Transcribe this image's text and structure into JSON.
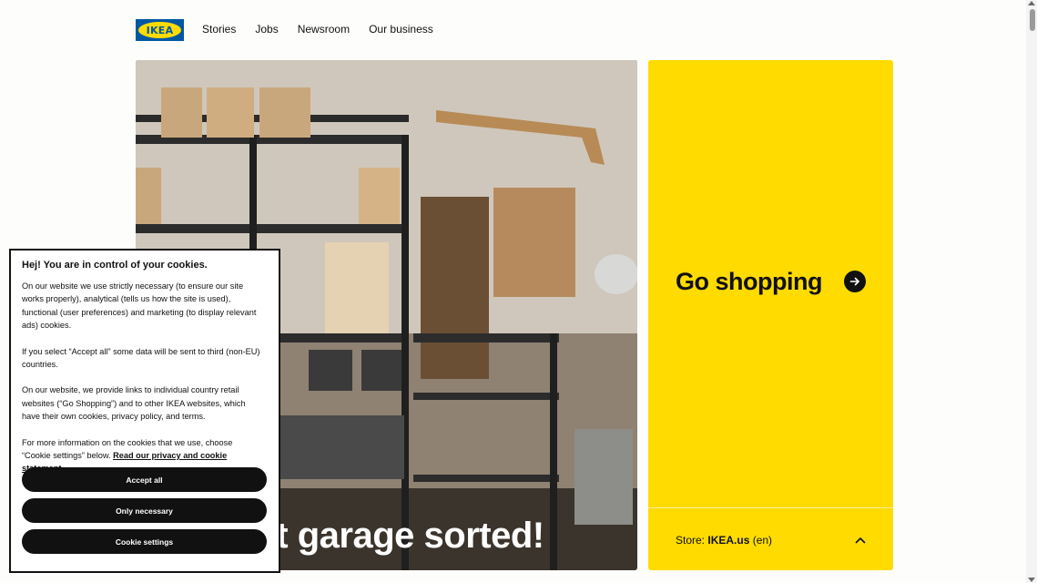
{
  "header": {
    "logo_text": "IKEA",
    "nav": [
      "Stories",
      "Jobs",
      "Newsroom",
      "Our business"
    ]
  },
  "hero": {
    "title": "Get that garage sorted!"
  },
  "shop": {
    "title": "Go shopping",
    "store_prefix": "Store: ",
    "store_name": "IKEA.us",
    "store_lang": " (en)"
  },
  "cookie": {
    "title": "Hej! You are in control of your cookies.",
    "p1": "On our website we use strictly necessary (to ensure our site works properly), analytical (tells us how the site is used), functional (user preferences) and marketing (to display relevant ads) cookies.",
    "p2": "If you select “Accept all” some data will be sent to third (non-EU) countries.",
    "p3": "On our website, we provide links to individual country retail websites (“Go Shopping”) and to other IKEA websites, which have their own cookies, privacy policy, and terms.",
    "p4": "For more information on the cookies that we use, choose “Cookie settings” below. ",
    "link": "Read our privacy and cookie statement.",
    "accept_all": "Accept all",
    "only_necessary": "Only necessary",
    "cookie_settings": "Cookie settings"
  },
  "colors": {
    "ikea_blue": "#0058a3",
    "ikea_yellow": "#ffdb00",
    "button_black": "#111111"
  }
}
